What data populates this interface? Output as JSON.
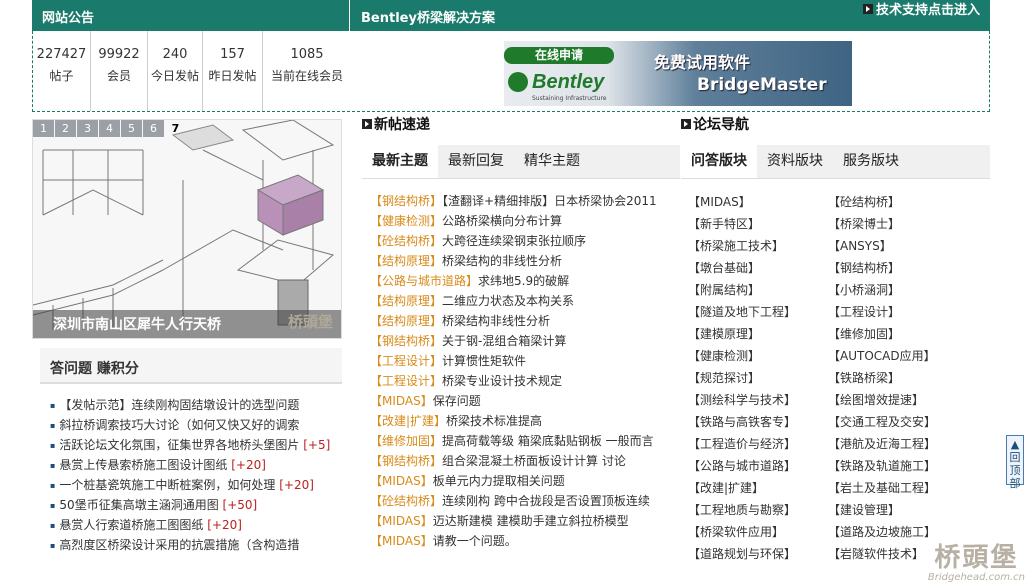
{
  "header": {
    "announcement_title": "网站公告",
    "solution_title": "Bentley桥梁解决方案",
    "support_link": "技术支持点击进入"
  },
  "stats": [
    {
      "value": "227427",
      "label": "帖子"
    },
    {
      "value": "99922",
      "label": "会员"
    },
    {
      "value": "240",
      "label": "今日发帖"
    },
    {
      "value": "157",
      "label": "昨日发帖"
    },
    {
      "value": "1085",
      "label": "当前在线会员"
    }
  ],
  "banner": {
    "apply": "在线申请",
    "brand": "Bentley",
    "tagline": "Sustaining Infrastructure",
    "free": "免费试用软件",
    "product": "BridgeMaster"
  },
  "slideshow": {
    "tabs": [
      "1",
      "2",
      "3",
      "4",
      "5",
      "6",
      "7"
    ],
    "active_tab": "7",
    "caption": "深圳市南山区犀牛人行天桥",
    "watermark": "桥頭堡"
  },
  "ask": {
    "title": "答问题 赚积分",
    "items": [
      {
        "text": "【发帖示范】连续刚构固结墩设计的选型问题",
        "bounty": ""
      },
      {
        "text": "斜拉桥调索技巧大讨论（如何又快又好的调索",
        "bounty": ""
      },
      {
        "text": "活跃论坛文化氛围，征集世界各地桥头堡图片 ",
        "bounty": "[+5]"
      },
      {
        "text": "悬赏上传悬索桥施工图设计图纸 ",
        "bounty": "[+20]"
      },
      {
        "text": "一个桩基瓷筑施工中断桩案例，如何处理 ",
        "bounty": "[+20]"
      },
      {
        "text": "50堡币征集高墩主涵洞通用图 ",
        "bounty": "[+50]"
      },
      {
        "text": "悬赏人行索道桥施工图图纸 ",
        "bounty": "[+20]"
      },
      {
        "text": "高烈度区桥梁设计采用的抗震措施（含构造措",
        "bounty": ""
      }
    ]
  },
  "new_posts": {
    "title": "新帖速递",
    "tabs": [
      "最新主题",
      "最新回复",
      "精华主题"
    ],
    "active_tab": "最新主题",
    "items": [
      {
        "cat": "【钢结构桥】",
        "text": "【渣翻译+精细排版】日本桥梁协会2011"
      },
      {
        "cat": "【健康检测】",
        "text": "公路桥梁横向分布计算"
      },
      {
        "cat": "【砼结构桥】",
        "text": "大跨径连续梁钢束张拉顺序"
      },
      {
        "cat": "【结构原理】",
        "text": "桥梁结构的非线性分析"
      },
      {
        "cat": "【公路与城市道路】",
        "text": "求纬地5.9的破解"
      },
      {
        "cat": "【结构原理】",
        "text": "二维应力状态及本构关系"
      },
      {
        "cat": "【结构原理】",
        "text": "桥梁结构非线性分析"
      },
      {
        "cat": "【钢结构桥】",
        "text": "关于钢-混组合箱梁计算"
      },
      {
        "cat": "【工程设计】",
        "text": "计算惯性矩软件"
      },
      {
        "cat": "【工程设计】",
        "text": "桥梁专业设计技术规定"
      },
      {
        "cat": "【MIDAS】",
        "text": "保存问题"
      },
      {
        "cat": "【改建|扩建】",
        "text": "桥梁技术标准提高"
      },
      {
        "cat": "【维修加固】",
        "text": "提高荷载等级 箱梁底黏贴钢板 一般而言"
      },
      {
        "cat": "【钢结构桥】",
        "text": "组合梁混凝土桥面板设计计算 讨论"
      },
      {
        "cat": "【MIDAS】",
        "text": "板单元内力提取相关问题"
      },
      {
        "cat": "【砼结构桥】",
        "text": "连续刚构 跨中合拢段是否设置顶板连续"
      },
      {
        "cat": "【MIDAS】",
        "text": "迈达斯建模 建模助手建立斜拉桥模型"
      },
      {
        "cat": "【MIDAS】",
        "text": "请教一个问题。"
      }
    ]
  },
  "forum_nav": {
    "title": "论坛导航",
    "tabs": [
      "问答版块",
      "资料版块",
      "服务版块"
    ],
    "active_tab": "问答版块",
    "col1": [
      "【MIDAS】",
      "【新手特区】",
      "【桥梁施工技术】",
      "【墩台基础】",
      "【附属结构】",
      "【隧道及地下工程】",
      "【建模原理】",
      "【健康检测】",
      "【规范探讨】",
      "【测绘科学与技术】",
      "【铁路与高铁客专】",
      "【工程造价与经济】",
      "【公路与城市道路】",
      "【改建|扩建】",
      "【工程地质与勘察】",
      "【桥梁软件应用】",
      "【道路规划与环保】"
    ],
    "col2": [
      "【砼结构桥】",
      "【桥梁博士】",
      "【ANSYS】",
      "【钢结构桥】",
      "【小桥涵洞】",
      "【工程设计】",
      "【维修加固】",
      "【AUTOCAD应用】",
      "【铁路桥梁】",
      "【绘图增效提速】",
      "【交通工程及交安】",
      "【港航及近海工程】",
      "【铁路及轨道施工】",
      "【岩土及基础工程】",
      "【建设管理】",
      "【道路及边坡施工】",
      "【岩隧软件技术】"
    ]
  },
  "back_to_top": "回顶部",
  "watermark": {
    "text": "桥頭堡",
    "url": "Bridgehead.com.cn"
  }
}
